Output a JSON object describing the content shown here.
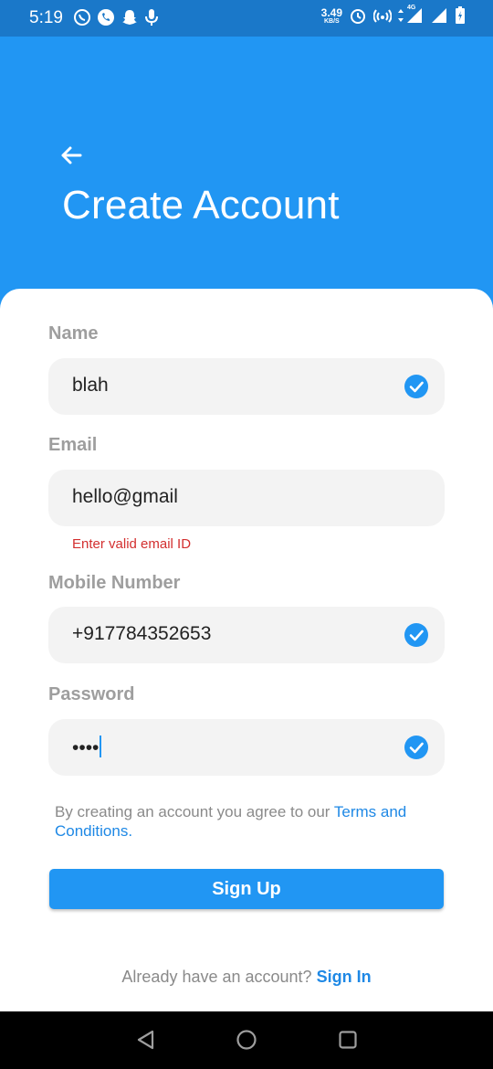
{
  "status_bar": {
    "time": "5:19",
    "left_icons": [
      "whatsapp-icon",
      "phone-icon",
      "snapchat-icon",
      "mic-icon"
    ],
    "net_speed_value": "3.49",
    "net_speed_unit": "KB/S",
    "network_type": "4G"
  },
  "header": {
    "back_icon": "arrow-left-icon",
    "title": "Create Account"
  },
  "form": {
    "name": {
      "label": "Name",
      "value": "blah",
      "valid": true
    },
    "email": {
      "label": "Email",
      "value": "hello@gmail",
      "valid": false,
      "error": "Enter valid email ID"
    },
    "mobile": {
      "label": "Mobile Number",
      "value": "+917784352653",
      "valid": true
    },
    "password": {
      "label": "Password",
      "value": "••••",
      "valid": true
    }
  },
  "terms": {
    "prefix": "By creating an account you agree to our ",
    "link": "Terms and Conditions",
    "suffix": "."
  },
  "signup_button": "Sign Up",
  "signin": {
    "prompt": "Already have an account? ",
    "link": "Sign In"
  },
  "colors": {
    "primary": "#2196F3",
    "status_bar": "#1a78c9",
    "error": "#d32f2f",
    "link": "#1e88e5"
  }
}
